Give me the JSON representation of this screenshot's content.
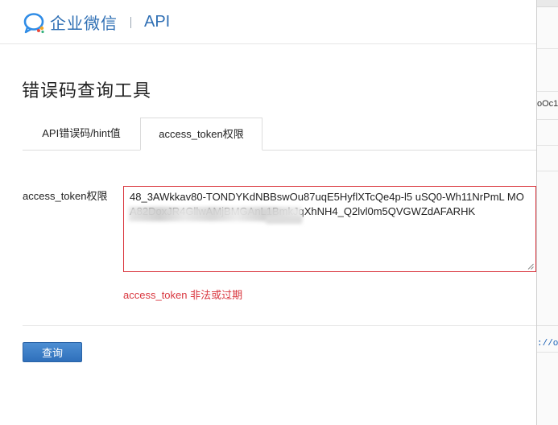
{
  "header": {
    "brand": "企业微信",
    "section": "API",
    "colors": {
      "brand": "#2f6fb4"
    }
  },
  "page": {
    "title": "错误码查询工具"
  },
  "tabs": [
    {
      "label": "API错误码/hint值",
      "active": false
    },
    {
      "label": "access_token权限",
      "active": true
    }
  ],
  "form": {
    "field_label": "access_token权限",
    "token_value": "48_3AWkkav80-TONDYKdNBBswOu87uqE5HyflXTcQe4p-l5                                  uSQ0-Wh11NrPmL                                 MOA82DoxJR4GllwAMjBMGAnL1BmkJqXhNH4_Q2lvl0m5QVGWZdAFARHK",
    "error_message": "access_token 非法或过期",
    "error_color": "#d9363e",
    "submit_label": "查询"
  },
  "side_panel": {
    "text1": "oOc1",
    "text2": "://o"
  }
}
